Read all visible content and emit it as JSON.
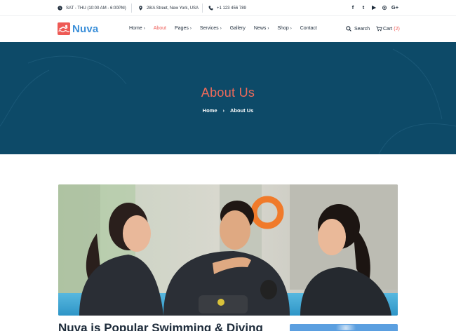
{
  "topbar": {
    "hours": "SAT - THU (10:00 AM - 6:00PM)",
    "address": "28/A Street, New York, USA",
    "phone": "+1 123 456 789",
    "social": [
      {
        "icon": "facebook-icon",
        "glyph": "f"
      },
      {
        "icon": "twitter-icon",
        "glyph": "t"
      },
      {
        "icon": "youtube-icon",
        "glyph": "▶"
      },
      {
        "icon": "instagram-icon",
        "glyph": "◎"
      },
      {
        "icon": "google-plus-icon",
        "glyph": "G+"
      }
    ]
  },
  "header": {
    "logo_text": "Nuva",
    "nav": [
      {
        "label": "Home",
        "dropdown": true
      },
      {
        "label": "About",
        "dropdown": false,
        "active": true
      },
      {
        "label": "Pages",
        "dropdown": true
      },
      {
        "label": "Services",
        "dropdown": true
      },
      {
        "label": "Gallery",
        "dropdown": false
      },
      {
        "label": "News",
        "dropdown": true
      },
      {
        "label": "Shop",
        "dropdown": true
      },
      {
        "label": "Contact",
        "dropdown": false
      }
    ],
    "search_label": "Search",
    "cart_label": "Cart",
    "cart_count": "(2)"
  },
  "hero": {
    "title": "About Us",
    "breadcrumb": [
      "Home",
      "About Us"
    ]
  },
  "content": {
    "section_title": "Nuva is Popular Swimming & Diving"
  },
  "colors": {
    "accent": "#ee5a55",
    "brand_blue": "#3b8fd9",
    "hero_bg": "#0d4a68"
  }
}
